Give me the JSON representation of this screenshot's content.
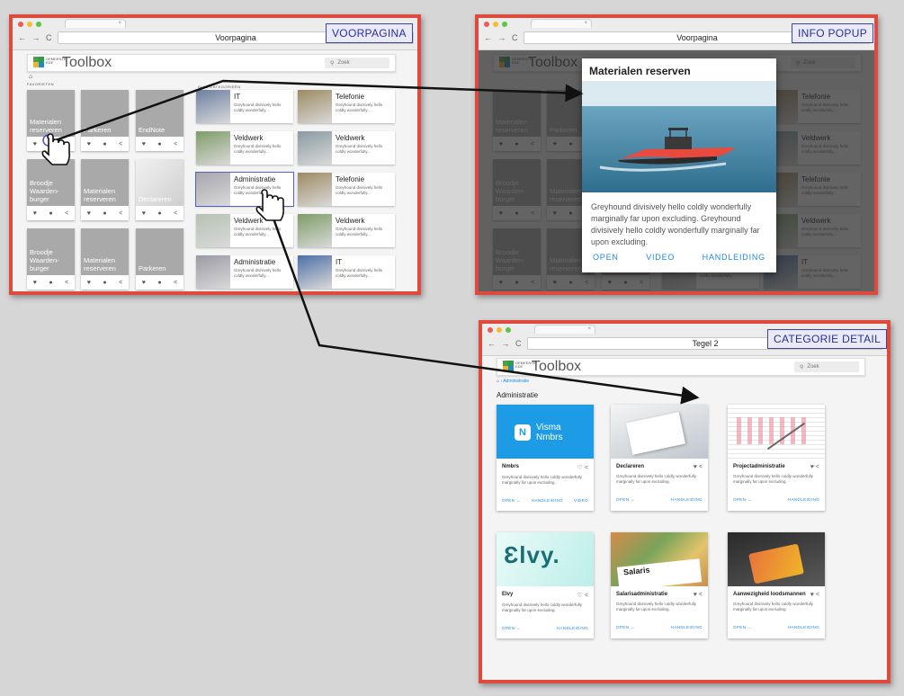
{
  "labels": {
    "voorpagina": "VOORPAGINA",
    "info": "INFO POPUP",
    "detail": "CATEGORIE DETAIL"
  },
  "browser": {
    "nav": "← → C",
    "tab_close": "×",
    "address_home": "Voorpagina",
    "address_detail": "Tegel 2"
  },
  "app": {
    "title": "Toolbox",
    "logo_text": "GEMEENTE EDE",
    "search_placeholder": "Zoek",
    "search_icon": "search-icon",
    "home_icon": "home-icon"
  },
  "home": {
    "favorites_label": "FAVORIETEN",
    "categories_label": "ALLE CATEGORIEËN",
    "favorites": [
      {
        "label": "Materialen reserveren"
      },
      {
        "label": "Parkeren"
      },
      {
        "label": "EndNote"
      },
      {
        "label": "Broodje Waarden-burger"
      },
      {
        "label": "Materialen reserveren"
      },
      {
        "label": "Declareren"
      },
      {
        "label": "Broodje Waarden-burger"
      },
      {
        "label": "Materialen reserveren"
      },
      {
        "label": "Parkeren"
      }
    ],
    "fav_actions": [
      "♥",
      "●",
      "<"
    ],
    "categories": [
      {
        "title": "IT",
        "desc": "Greyhound divisively hello coldly wonderfully..."
      },
      {
        "title": "Telefonie",
        "desc": "Greyhound divisively hello coldly wonderfully..."
      },
      {
        "title": "Veldwerk",
        "desc": "Greyhound divisively hello coldly wonderfully..."
      },
      {
        "title": "Veldwerk",
        "desc": "Greyhound divisively hello coldly wonderfully..."
      },
      {
        "title": "Administratie",
        "desc": "Greyhound divisively hello coldly wonderfully..."
      },
      {
        "title": "Telefonie",
        "desc": "Greyhound divisively hello coldly wonderfully..."
      },
      {
        "title": "Veldwerk",
        "desc": "Greyhound divisively hello coldly wonderfully..."
      },
      {
        "title": "Veldwerk",
        "desc": "Greyhound divisively hello coldly wonderfully..."
      },
      {
        "title": "Administratie",
        "desc": "Greyhound divisively hello coldly wonderfully..."
      },
      {
        "title": "IT",
        "desc": "Greyhound divisively hello coldly wonderfully..."
      }
    ]
  },
  "popup": {
    "title": "Materialen reserven",
    "text": "Greyhound divisively hello coldly wonderfully marginally far upon excluding. Greyhound divisively hello coldly wonderfully marginally far upon excluding.",
    "open": "OPEN",
    "video": "VIDEO",
    "manual": "HANDLEIDING"
  },
  "detail": {
    "breadcrumb": "› Administratie",
    "heading": "Administratie",
    "cards": [
      {
        "title": "Nmbrs",
        "img_text": "Visma Nmbrs",
        "desc": "Greyhound divisively hello coldly wonderfully marginally far upon excluding.",
        "actions": [
          "OPEN →",
          "HANDLEIDING",
          "VIDEO"
        ]
      },
      {
        "title": "Declareren",
        "desc": "Greyhound divisively hello coldly wonderfully marginally far upon excluding.",
        "actions": [
          "OPEN →",
          "HANDLEIDING"
        ]
      },
      {
        "title": "Projectadministratie",
        "desc": "Greyhound divisively hello coldly wonderfully marginally far upon excluding.",
        "actions": [
          "OPEN →",
          "HANDLEIDING"
        ]
      },
      {
        "title": "Elvy",
        "img_text": "Ɛlvy.",
        "desc": "Greyhound divisively hello coldly wonderfully marginally far upon excluding.",
        "actions": [
          "OPEN →",
          "HANDLEIDING"
        ]
      },
      {
        "title": "Salarisadministratie",
        "img_text": "Salaris",
        "desc": "Greyhound divisively hello coldly wonderfully marginally far upon excluding.",
        "actions": [
          "OPEN →",
          "HANDLEIDING"
        ]
      },
      {
        "title": "Aanwezigheid loodsmannen",
        "desc": "Greyhound divisively hello coldly wonderfully marginally far upon excluding.",
        "actions": [
          "OPEN →",
          "HANDLEIDING"
        ]
      }
    ]
  },
  "colors": {
    "frame": "#e04a3c",
    "label_border": "#3b43a8",
    "accent": "#1e88e5"
  }
}
